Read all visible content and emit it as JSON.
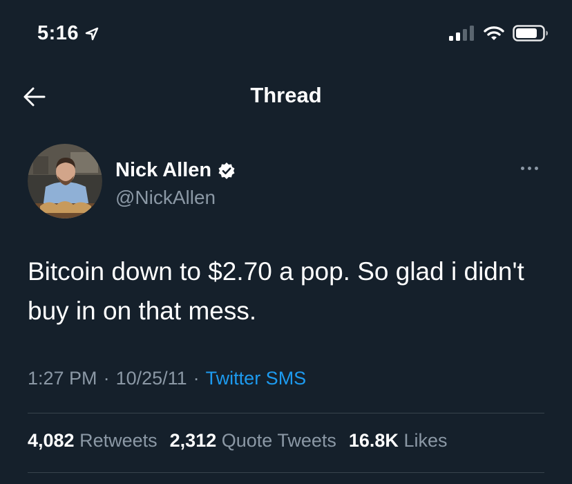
{
  "status_bar": {
    "time": "5:16",
    "location_icon": "location-arrow-icon",
    "signal_icon": "cellular-signal-icon",
    "wifi_icon": "wifi-icon",
    "battery_icon": "battery-icon"
  },
  "nav": {
    "title": "Thread",
    "back_icon": "back-arrow-icon"
  },
  "author": {
    "name": "Nick Allen",
    "handle": "@NickAllen",
    "verified": true,
    "verified_icon": "verified-badge-icon",
    "more_icon": "more-options-icon"
  },
  "tweet": {
    "text": "Bitcoin down to $2.70 a pop. So glad i didn't buy in on that mess.",
    "time": "1:27 PM",
    "date": "10/25/11",
    "source": "Twitter SMS",
    "separator": "·"
  },
  "stats": {
    "retweets_count": "4,082",
    "retweets_label": "Retweets",
    "quotes_count": "2,312",
    "quotes_label": "Quote Tweets",
    "likes_count": "16.8K",
    "likes_label": "Likes"
  },
  "colors": {
    "background": "#15202b",
    "accent": "#1d9bf0",
    "secondary_text": "#8b98a5",
    "divider": "#38444d"
  }
}
